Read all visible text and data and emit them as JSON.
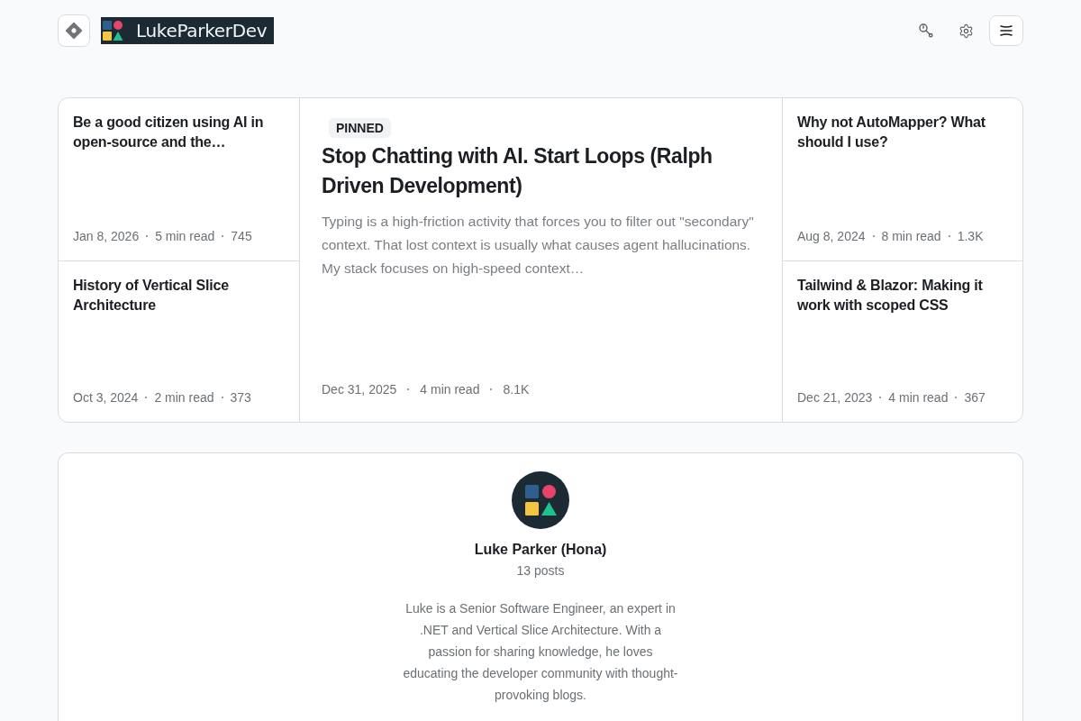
{
  "header": {
    "brand": "LukeParkerDev"
  },
  "posts": {
    "left": [
      {
        "title": "Be a good citizen using AI in open-source and the…",
        "date": "Jan 8, 2026",
        "read_time": "5 min read",
        "views": "745"
      },
      {
        "title": "History of Vertical Slice Architecture",
        "date": "Oct 3, 2024",
        "read_time": "2 min read",
        "views": "373"
      }
    ],
    "featured": {
      "badge": "PINNED",
      "title": "Stop Chatting with AI. Start Loops (Ralph Driven Development)",
      "excerpt": "Typing is a high-friction activity that forces you to filter out \"secondary\" context. That lost context is usually what causes agent hallucinations. My stack focuses on high-speed context…",
      "date": "Dec 31, 2025",
      "read_time": "4 min read",
      "views": "8.1K"
    },
    "right": [
      {
        "title": "Why not AutoMapper? What should I use?",
        "date": "Aug 8, 2024",
        "read_time": "8 min read",
        "views": "1.3K"
      },
      {
        "title": "Tailwind & Blazor: Making it work with scoped CSS",
        "date": "Dec 21, 2023",
        "read_time": "4 min read",
        "views": "367"
      }
    ]
  },
  "author": {
    "name": "Luke Parker (Hona)",
    "post_count": "13 posts",
    "bio": "Luke is a Senior Software Engineer, an expert in .NET and Vertical Slice Architecture. With a passion for sharing knowledge, he loves educating the developer community with thought-provoking blogs."
  }
}
